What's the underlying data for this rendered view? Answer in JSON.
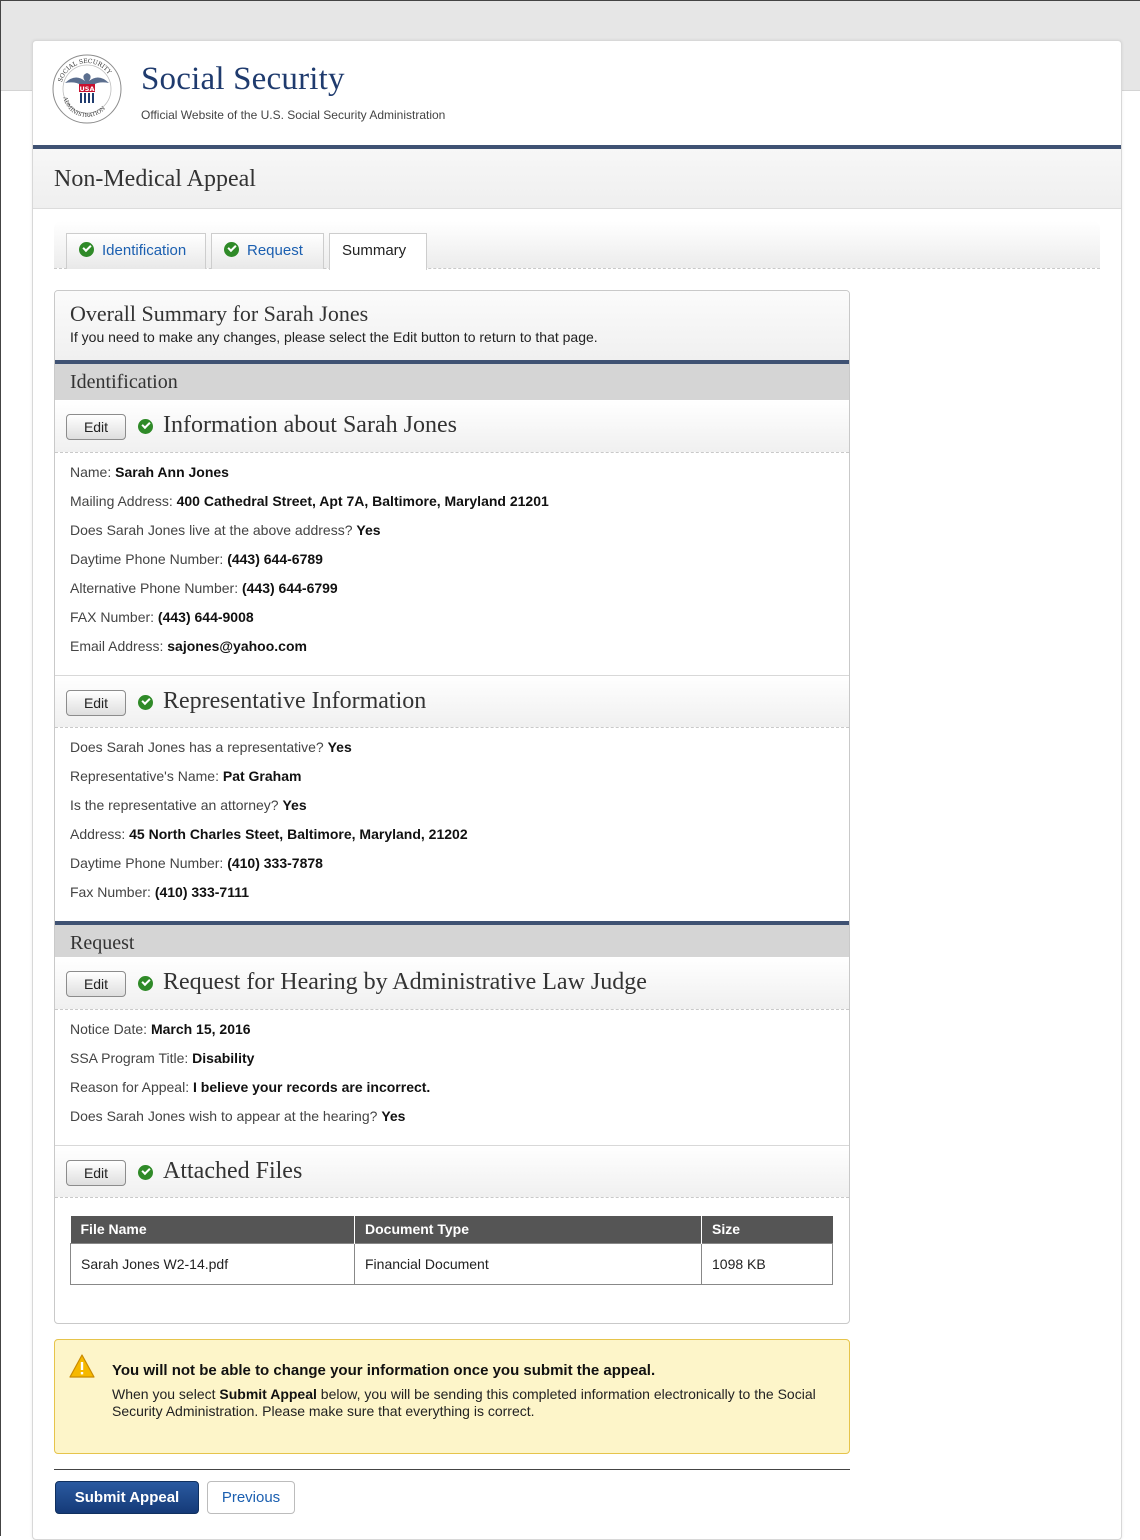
{
  "header": {
    "site_title": "Social Security",
    "site_subtitle": "Official Website of the U.S. Social Security Administration",
    "seal_text": "SOCIAL SECURITY ADMINISTRATION USA",
    "seal_badge": "USA"
  },
  "page": {
    "title": "Non-Medical Appeal"
  },
  "tabs": [
    {
      "label": "Identification",
      "completed": true
    },
    {
      "label": "Request",
      "completed": true
    },
    {
      "label": "Summary",
      "completed": false,
      "active": true
    }
  ],
  "summary": {
    "title": "Overall Summary for Sarah Jones",
    "subtitle": "If you need to make any changes, please select the Edit button to return to that page.",
    "edit_label": "Edit",
    "sections": {
      "identification": {
        "label": "Identification",
        "info": {
          "title": "Information about Sarah Jones",
          "fields": [
            {
              "label": "Name:",
              "value": "Sarah Ann Jones"
            },
            {
              "label": "Mailing Address:",
              "value": "400 Cathedral Street, Apt 7A, Baltimore, Maryland 21201"
            },
            {
              "label": "Does Sarah Jones live at the above address?",
              "value": "Yes"
            },
            {
              "label": "Daytime Phone Number:",
              "value": "(443) 644-6789"
            },
            {
              "label": "Alternative Phone Number:",
              "value": "(443) 644-6799"
            },
            {
              "label": "FAX Number:",
              "value": "(443) 644-9008"
            },
            {
              "label": "Email Address:",
              "value": "sajones@yahoo.com"
            }
          ]
        },
        "rep": {
          "title": "Representative Information",
          "fields": [
            {
              "label": "Does Sarah Jones has a representative?",
              "value": "Yes"
            },
            {
              "label": "Representative's Name:",
              "value": "Pat Graham"
            },
            {
              "label": "Is the representative an attorney?",
              "value": "Yes"
            },
            {
              "label": "Address:",
              "value": "45 North Charles Steet, Baltimore, Maryland, 21202"
            },
            {
              "label": "Daytime Phone Number:",
              "value": "(410) 333-7878"
            },
            {
              "label": "Fax Number:",
              "value": "(410) 333-7111"
            }
          ]
        }
      },
      "request": {
        "label": "Request",
        "hearing": {
          "title": "Request for Hearing by Administrative Law Judge",
          "fields": [
            {
              "label": "Notice Date:",
              "value": "March 15, 2016"
            },
            {
              "label": "SSA Program Title:",
              "value": "Disability"
            },
            {
              "label": "Reason for Appeal:",
              "value": "I believe your records are incorrect."
            },
            {
              "label": "Does Sarah Jones wish to appear at the hearing?",
              "value": "Yes"
            }
          ]
        },
        "files": {
          "title": "Attached Files",
          "columns": [
            "File Name",
            "Document Type",
            "Size"
          ],
          "rows": [
            [
              "Sarah Jones W2-14.pdf",
              "Financial Document",
              "1098 KB"
            ]
          ]
        }
      }
    }
  },
  "warning": {
    "title": "You will not be able to change your information once you submit the appeal.",
    "body_pre": "When you select",
    "body_strong": "Submit Appeal",
    "body_post": "below, you will be sending this completed information electronically to the Social Security Administration. Please make sure that everything is correct."
  },
  "actions": {
    "submit_label": "Submit Appeal",
    "previous_label": "Previous"
  },
  "colors": {
    "brand_navy": "#1f3b6e",
    "rule_blue": "#3f5273",
    "check_green": "#2f8a28",
    "warning_bg": "#fdf5c9"
  }
}
